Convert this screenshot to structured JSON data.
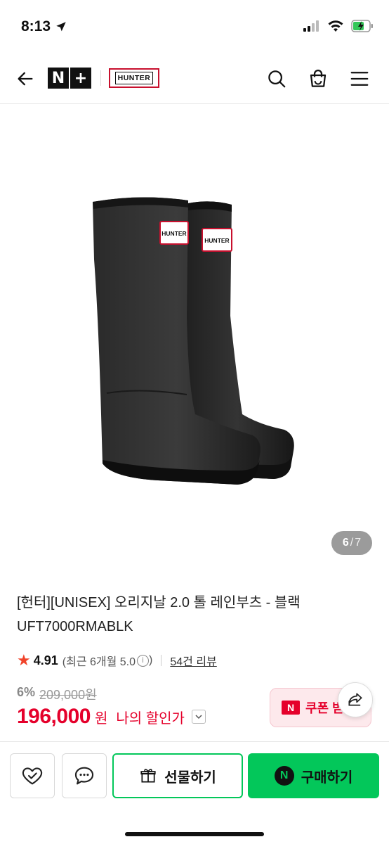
{
  "status_bar": {
    "time": "8:13",
    "icons": [
      "location-arrow-icon",
      "signal-icon",
      "wifi-icon",
      "battery-charging-icon"
    ]
  },
  "header": {
    "back_icon": "arrow-left-icon",
    "store_logo_left": "N",
    "store_logo_right": "+",
    "brand_logo": "HUNTER",
    "icons": [
      "search-icon",
      "shopping-bag-icon",
      "menu-icon"
    ]
  },
  "gallery": {
    "current": "6",
    "separator": "/",
    "total": "7",
    "product_logo": "HUNTER"
  },
  "product": {
    "title_line1": "[헌터][UNISEX] 오리지날 2.0 톨 레인부츠 - 블랙",
    "title_line2": "UFT7000RMABLK",
    "rating": "4.91",
    "recent_rating": "(최근 6개월 5.0",
    "reviews": "54건 리뷰",
    "discount_pct": "6%",
    "original_price": "209,000원",
    "price": "196,000",
    "price_unit": "원",
    "my_discount_label": "나의 할인가"
  },
  "coupon": {
    "icon_letter": "N",
    "label": "쿠폰 받"
  },
  "bottom_bar": {
    "gift_label": "선물하기",
    "buy_icon_letter": "N",
    "buy_label": "구매하기"
  },
  "colors": {
    "naver_green": "#03c75a",
    "price_red": "#e5002b",
    "hunter_red": "#c8102e",
    "star": "#f0432a"
  }
}
